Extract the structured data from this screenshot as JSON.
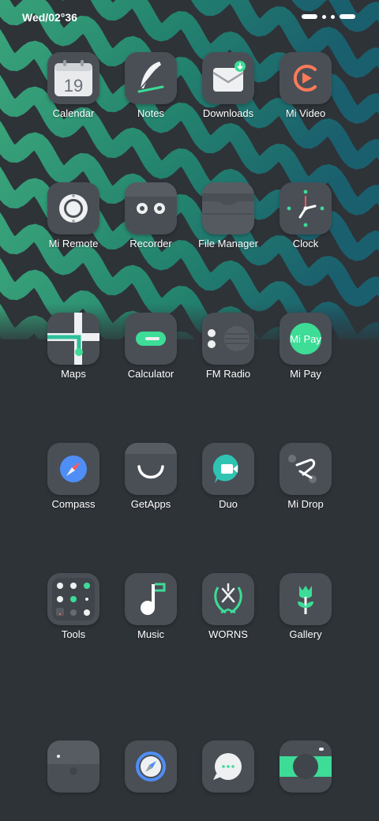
{
  "status_bar": {
    "time": "Wed/02°36"
  },
  "apps": [
    {
      "label": "Calendar",
      "icon": "calendar-icon",
      "badge": "19"
    },
    {
      "label": "Notes",
      "icon": "feather-icon"
    },
    {
      "label": "Downloads",
      "icon": "download-mail-icon"
    },
    {
      "label": "Mi Video",
      "icon": "play-ring-icon"
    },
    {
      "label": "Mi Remote",
      "icon": "remote-ring-icon"
    },
    {
      "label": "Recorder",
      "icon": "cassette-icon"
    },
    {
      "label": "File Manager",
      "icon": "drawer-icon"
    },
    {
      "label": "Clock",
      "icon": "clock-icon"
    },
    {
      "label": "Maps",
      "icon": "map-cross-icon"
    },
    {
      "label": "Calculator",
      "icon": "toggle-pill-icon"
    },
    {
      "label": "FM Radio",
      "icon": "radio-speaker-icon"
    },
    {
      "label": "Mi Pay",
      "icon": "mi-pay-badge-icon",
      "badge": "Mi Pay"
    },
    {
      "label": "Compass",
      "icon": "compass-icon"
    },
    {
      "label": "GetApps",
      "icon": "smile-bag-icon"
    },
    {
      "label": "Duo",
      "icon": "video-chat-icon"
    },
    {
      "label": "Mi Drop",
      "icon": "drop-share-icon"
    },
    {
      "label": "Tools",
      "icon": "tools-grid-icon"
    },
    {
      "label": "Music",
      "icon": "music-note-icon"
    },
    {
      "label": "WORNS",
      "icon": "laurel-wreath-icon"
    },
    {
      "label": "Gallery",
      "icon": "tulip-icon"
    }
  ],
  "dock": [
    {
      "icon": "phone-handset-icon"
    },
    {
      "icon": "browser-compass-icon"
    },
    {
      "icon": "message-bubble-icon"
    },
    {
      "icon": "camera-icon"
    }
  ],
  "colors": {
    "background": "#2e3338",
    "accent_green": "#3ddc97",
    "wave_green": "#2f9e77",
    "wave_teal": "#1f6f78",
    "icon_tile": "#4a4f56"
  }
}
